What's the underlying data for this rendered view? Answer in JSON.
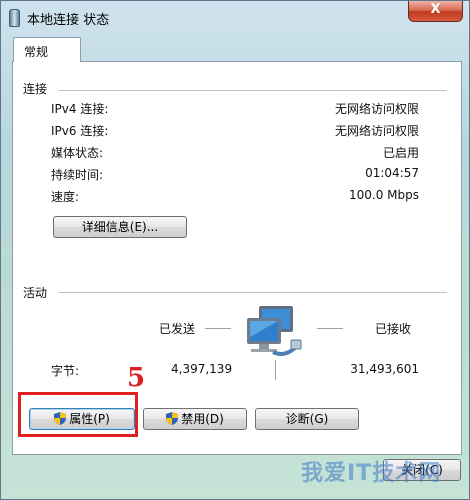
{
  "window": {
    "title": "本地连接 状态",
    "close_glyph": "X"
  },
  "tabs": [
    {
      "label": "常规"
    }
  ],
  "connection": {
    "section_title": "连接",
    "rows": [
      {
        "label": "IPv4 连接:",
        "value": "无网络访问权限"
      },
      {
        "label": "IPv6 连接:",
        "value": "无网络访问权限"
      },
      {
        "label": "媒体状态:",
        "value": "已启用"
      },
      {
        "label": "持续时间:",
        "value": "01:04:57"
      },
      {
        "label": "速度:",
        "value": "100.0 Mbps"
      }
    ],
    "details_button": "详细信息(E)..."
  },
  "activity": {
    "section_title": "活动",
    "sent_label": "已发送",
    "received_label": "已接收",
    "bytes_label": "字节:",
    "bytes_sent": "4,397,139",
    "bytes_received": "31,493,601",
    "icon": "network-computers-icon"
  },
  "buttons": {
    "properties": "属性(P)",
    "disable": "禁用(D)",
    "diagnose": "诊断(G)",
    "close": "关闭(C)"
  },
  "annotation": {
    "step_number": "5",
    "color": "#e02020"
  },
  "watermark": {
    "text": "我爱IT技术网"
  }
}
